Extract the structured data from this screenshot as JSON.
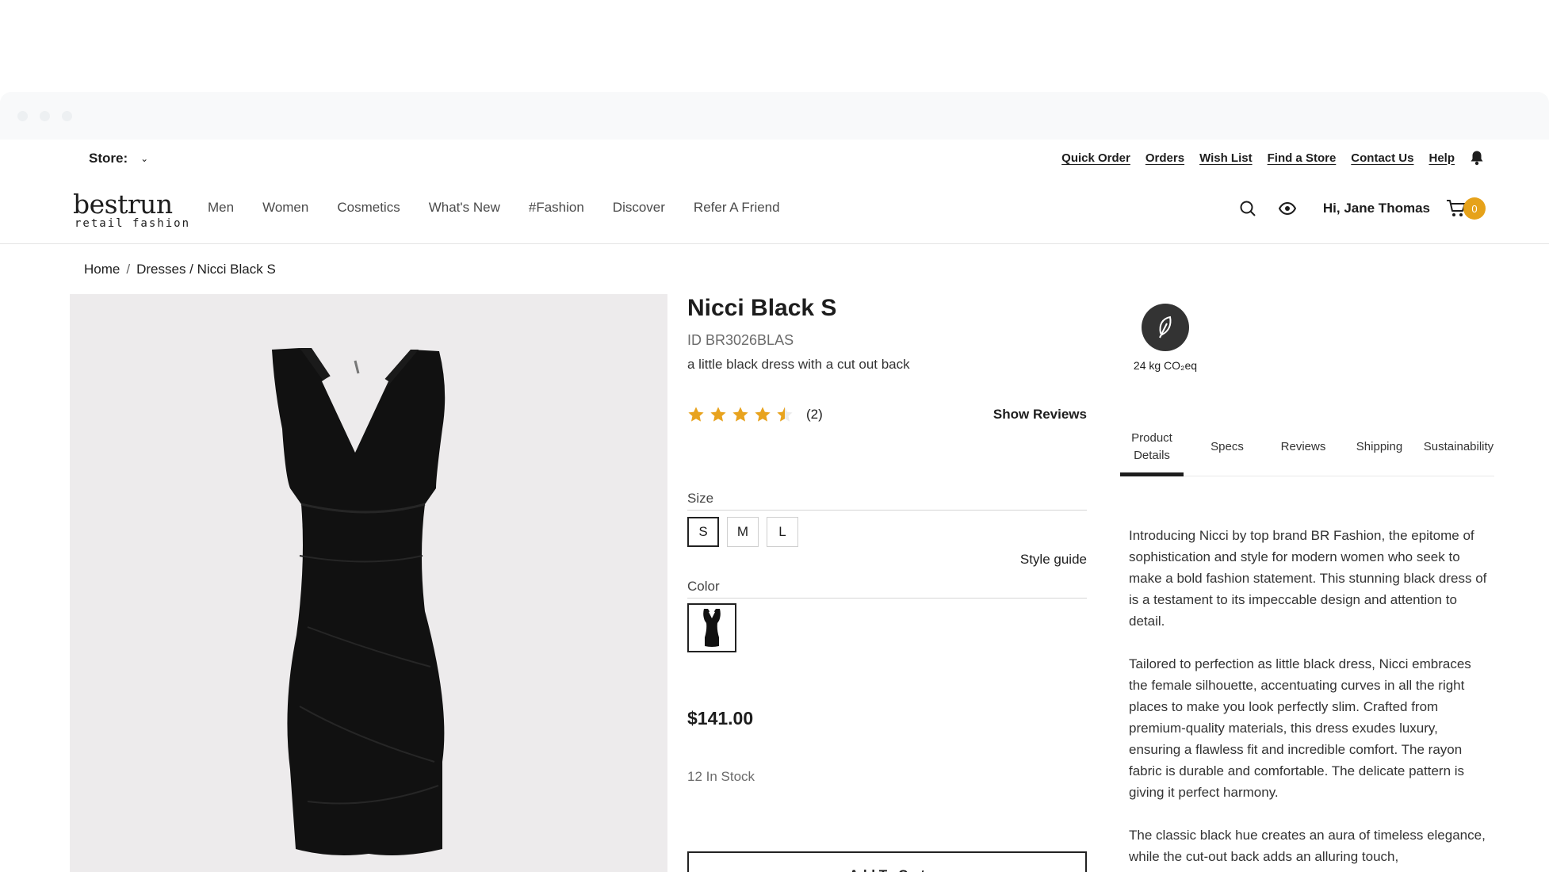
{
  "utility": {
    "store_label": "Store:",
    "links": [
      "Quick Order",
      "Orders",
      "Wish List",
      "Find a Store",
      "Contact Us",
      "Help"
    ]
  },
  "header": {
    "logo_name": "bestrun",
    "logo_sub": "retail fashion",
    "nav": [
      "Men",
      "Women",
      "Cosmetics",
      "What's New",
      "#Fashion",
      "Discover",
      "Refer A Friend"
    ],
    "greeting": "Hi, Jane Thomas",
    "cart_count": "0"
  },
  "breadcrumb": {
    "home": "Home",
    "sep": "/",
    "path": "Dresses / Nicci Black S"
  },
  "product": {
    "title": "Nicci Black S",
    "id": "ID BR3026BLAS",
    "tagline": "a little black dress with a cut out back",
    "rating": 4.5,
    "rating_count": "(2)",
    "show_reviews": "Show Reviews",
    "size_label": "Size",
    "sizes": [
      "S",
      "M",
      "L"
    ],
    "selected_size": "S",
    "style_guide": "Style guide",
    "color_label": "Color",
    "price": "$141.00",
    "stock": "12 In Stock",
    "add_to_cart": "Add To Cart"
  },
  "sustainability": {
    "co2": "24 kg CO₂eq"
  },
  "tabs": [
    "Product Details",
    "Specs",
    "Reviews",
    "Shipping",
    "Sustainability"
  ],
  "description": [
    "Introducing Nicci by top brand BR Fashion, the epitome of sophistication and style for modern women who seek to make a bold fashion statement. This stunning black dress of is a testament to its impeccable design and attention to detail.",
    "Tailored to perfection as little black dress, Nicci embraces the female silhouette, accentuating curves in all the right places to make you look perfectly slim. Crafted from premium-quality materials, this dress exudes luxury, ensuring a flawless fit and incredible comfort. The rayon fabric is durable and comfortable. The delicate pattern is giving it perfect harmony.",
    "The classic black hue creates an aura of timeless elegance, while the cut-out back adds an alluring touch,"
  ],
  "colors": {
    "accent": "#e6a21a",
    "star": "#e8a31e",
    "dark": "#1d1d1d"
  }
}
